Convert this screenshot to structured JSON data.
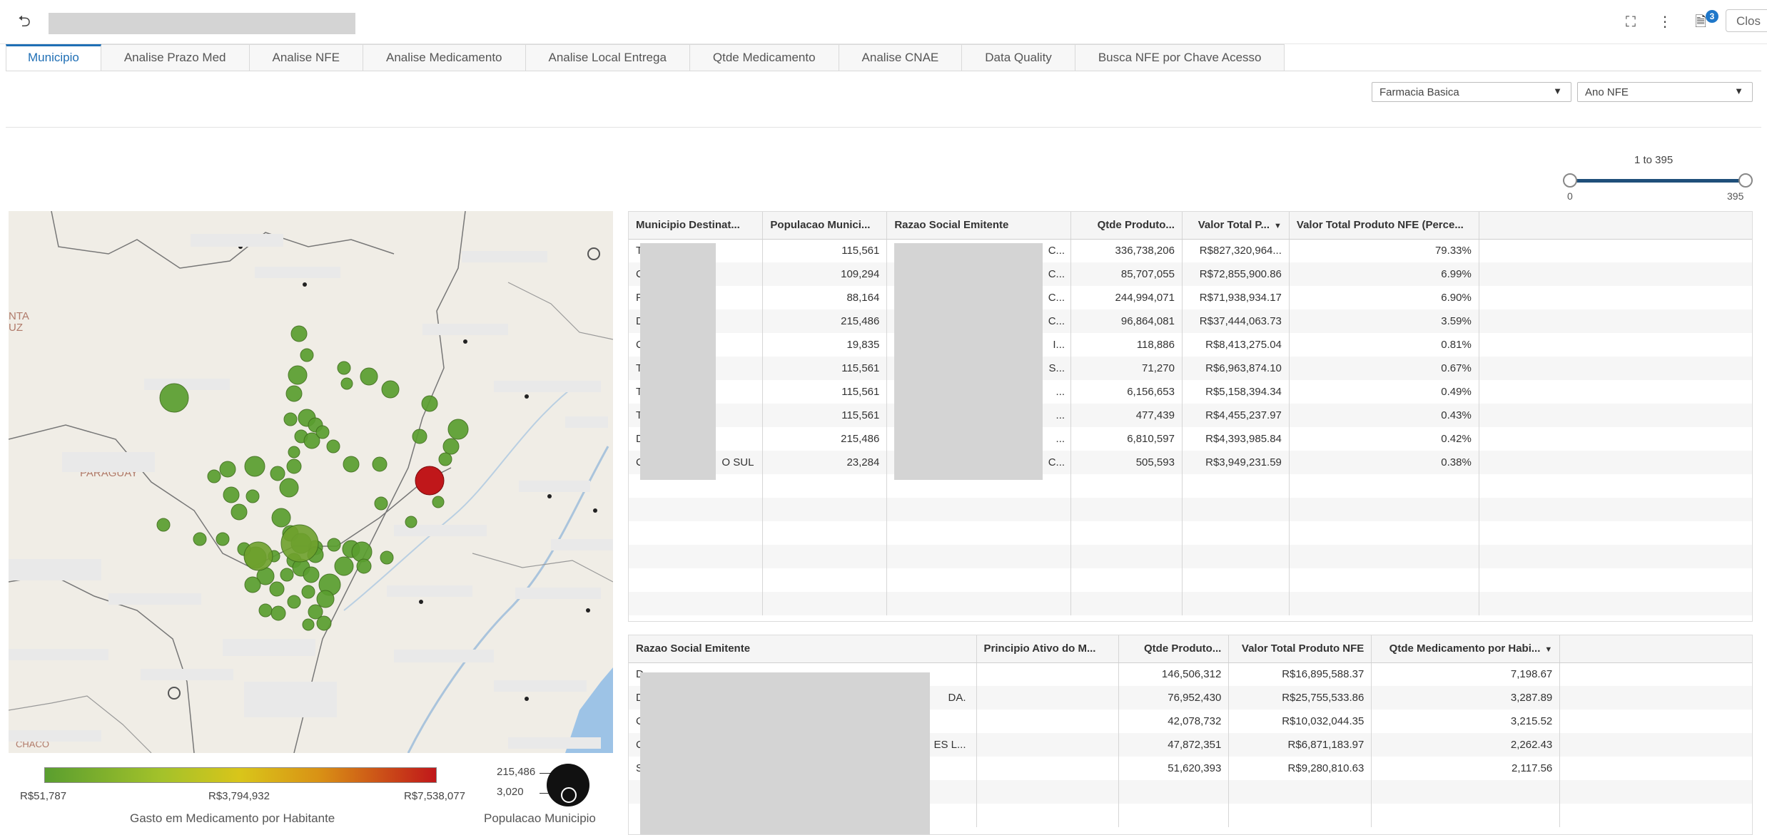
{
  "header": {
    "back_icon": "undo-arrow-icon",
    "close_label": "Clos",
    "notification_count": "3",
    "icons": [
      "expand-icon",
      "more-vertical-icon",
      "report-icon"
    ]
  },
  "tabs": [
    {
      "label": "Municipio",
      "active": true
    },
    {
      "label": "Analise Prazo Med"
    },
    {
      "label": "Analise NFE"
    },
    {
      "label": "Analise Medicamento"
    },
    {
      "label": "Analise Local Entrega"
    },
    {
      "label": "Qtde Medicamento"
    },
    {
      "label": "Analise CNAE"
    },
    {
      "label": "Data Quality"
    },
    {
      "label": "Busca NFE por Chave Acesso"
    }
  ],
  "filters": {
    "program": "Farmacia Basica",
    "year": "Ano NFE"
  },
  "slider": {
    "label": "1 to 395",
    "min": "0",
    "max": "395"
  },
  "map": {
    "labels": [
      "PARAGUAY",
      "NTA",
      "UZ",
      "CHACO"
    ],
    "bubble_color_low": "#5a9e2f",
    "bubble_color_high": "#c0171a"
  },
  "legend": {
    "color_min": "R$51,787",
    "color_mid": "R$3,794,932",
    "color_max": "R$7,538,077",
    "color_title": "Gasto em Medicamento por Habitante",
    "size_max": "215,486",
    "size_min": "3,020",
    "size_title": "Populacao Municipio"
  },
  "table1": {
    "headers": [
      "Municipio Destinat...",
      "Populacao Munici...",
      "Razao Social Emitente",
      "Qtde Produto...",
      "Valor Total P...",
      "Valor Total Produto NFE (Perce..."
    ],
    "rows": [
      {
        "municipio": "T",
        "populacao": "115,561",
        "razao": "C",
        "razao_end": "C...",
        "qtde": "336,738,206",
        "valor": "R$827,320,964...",
        "perc": "79.33%"
      },
      {
        "municipio": "C",
        "populacao": "109,294",
        "razao": "C",
        "razao_end": "C...",
        "qtde": "85,707,055",
        "valor": "R$72,855,900.86",
        "perc": "6.99%"
      },
      {
        "municipio": "F",
        "populacao": "88,164",
        "razao": "C",
        "razao_end": "C...",
        "qtde": "244,994,071",
        "valor": "R$71,938,934.17",
        "perc": "6.90%"
      },
      {
        "municipio": "D",
        "populacao": "215,486",
        "razao": "C",
        "razao_end": "C...",
        "qtde": "96,864,081",
        "valor": "R$37,444,063.73",
        "perc": "3.59%"
      },
      {
        "municipio": "C",
        "populacao": "19,835",
        "razao": "F",
        "razao_end": "I...",
        "qtde": "118,886",
        "valor": "R$8,413,275.04",
        "perc": "0.81%"
      },
      {
        "municipio": "T",
        "populacao": "115,561",
        "razao": "S",
        "razao_end": "S...",
        "qtde": "71,270",
        "valor": "R$6,963,874.10",
        "perc": "0.67%"
      },
      {
        "municipio": "T",
        "populacao": "115,561",
        "razao": "D",
        "razao_end": "...",
        "qtde": "6,156,653",
        "valor": "R$5,158,394.34",
        "perc": "0.49%"
      },
      {
        "municipio": "T",
        "populacao": "115,561",
        "razao": "C",
        "razao_end": "...",
        "qtde": "477,439",
        "valor": "R$4,455,237.97",
        "perc": "0.43%"
      },
      {
        "municipio": "D",
        "populacao": "215,486",
        "razao": "C",
        "razao_end": "...",
        "qtde": "6,810,597",
        "valor": "R$4,393,985.84",
        "perc": "0.42%"
      },
      {
        "municipio": "C",
        "municipio_end": "O SUL",
        "populacao": "23,284",
        "razao": "A",
        "razao_end": "C...",
        "qtde": "505,593",
        "valor": "R$3,949,231.59",
        "perc": "0.38%"
      }
    ]
  },
  "table2": {
    "headers": [
      "Razao Social Emitente",
      "Principio Ativo do M...",
      "Qtde Produto...",
      "Valor Total Produto NFE",
      "Qtde Medicamento por Habi..."
    ],
    "rows": [
      {
        "razao": "D",
        "razao_end": "",
        "principio": "",
        "qtde": "146,506,312",
        "valor": "R$16,895,588.37",
        "por_hab": "7,198.67"
      },
      {
        "razao": "D",
        "razao_end": "DA.",
        "principio": "",
        "qtde": "76,952,430",
        "valor": "R$25,755,533.86",
        "por_hab": "3,287.89"
      },
      {
        "razao": "C",
        "razao_end": "",
        "principio": "",
        "qtde": "42,078,732",
        "valor": "R$10,032,044.35",
        "por_hab": "3,215.52"
      },
      {
        "razao": "C",
        "razao_end": "ES L...",
        "principio": "",
        "qtde": "47,872,351",
        "valor": "R$6,871,183.97",
        "por_hab": "2,262.43"
      },
      {
        "razao": "S",
        "razao_end": "",
        "principio": "",
        "qtde": "51,620,393",
        "valor": "R$9,280,810.63",
        "por_hab": "2,117.56"
      }
    ]
  }
}
